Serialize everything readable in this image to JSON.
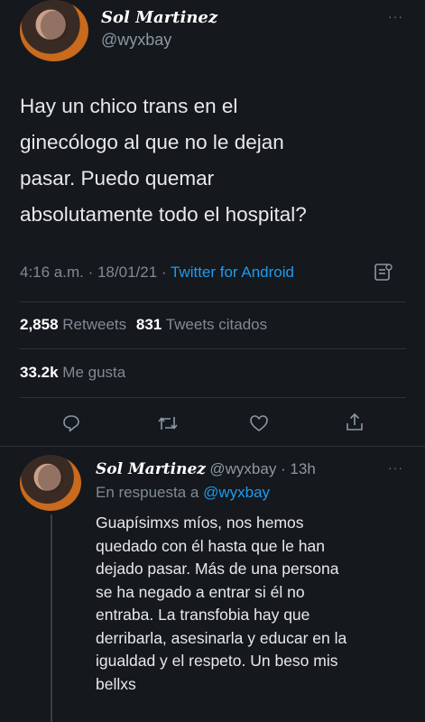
{
  "main_tweet": {
    "author_name": "Sol Martinez",
    "handle": "@wyxbay",
    "text_lines": [
      "Hay un chico trans en el",
      "ginecólogo al que no le dejan",
      "pasar. Puedo quemar",
      "absolutamente todo el hospital?"
    ],
    "time": "4:16 a.m. · 18/01/21 · ",
    "source": "Twitter for Android",
    "retweets_count": "2,858",
    "retweets_label": "Retweets",
    "quotes_count": "831",
    "quotes_label": "Tweets citados",
    "likes_count": "33.2k",
    "likes_label": "Me gusta"
  },
  "reply_tweet": {
    "author_name": "Sol Martinez",
    "handle_time": "@wyxbay · 13h",
    "replying_to_label": "En respuesta a ",
    "replying_to_handle": "@wyxbay",
    "text_lines": [
      "Guapísimxs míos, nos hemos",
      "quedado con él hasta que le han",
      "dejado pasar. Más de una persona",
      "se ha negado a entrar si él no",
      "entraba. La transfobia hay que",
      "derribarla, asesinarla y educar en la",
      "igualdad y el respeto. Un beso mis",
      "bellxs"
    ]
  },
  "more_label": "···",
  "colors": {
    "background": "#15181c",
    "accent": "#1d9bf0",
    "muted": "#7f8a95"
  },
  "icons": [
    "reply-icon",
    "retweet-icon",
    "like-icon",
    "share-icon",
    "analytics-icon",
    "more-icon"
  ]
}
